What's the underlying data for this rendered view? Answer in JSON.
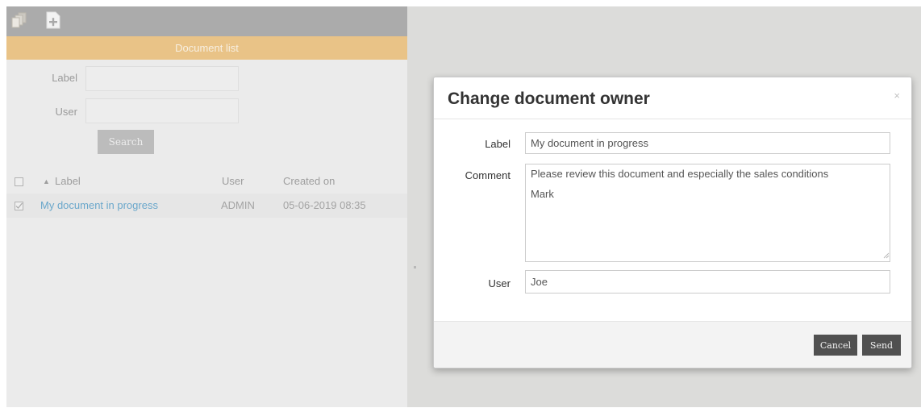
{
  "toolbar": {
    "documents_icon": "documents-icon",
    "add_icon": "add-document-icon"
  },
  "list_panel": {
    "header": "Document list",
    "filters": {
      "label_label": "Label",
      "label_value": "",
      "user_label": "User",
      "user_value": ""
    },
    "search_button": "Search",
    "columns": {
      "sort_indicator": "▲",
      "label": "Label",
      "user": "User",
      "created_on": "Created on"
    },
    "rows": [
      {
        "label": "My document in progress",
        "user": "ADMIN",
        "created_on": "05-06-2019 08:35",
        "checked": true
      }
    ]
  },
  "modal": {
    "title": "Change document owner",
    "close": "×",
    "label_label": "Label",
    "label_value": "My document in progress",
    "comment_label": "Comment",
    "comment_line1": "Please review this document and especially the sales conditions",
    "comment_line2": "Mark",
    "user_label": "User",
    "user_value": "Joe",
    "cancel_button": "Cancel",
    "send_button": "Send"
  },
  "colors": {
    "header_accent": "#e9c387",
    "link": "#6aa7cb",
    "toolbar": "#ababab",
    "dark_button": "#505050"
  }
}
